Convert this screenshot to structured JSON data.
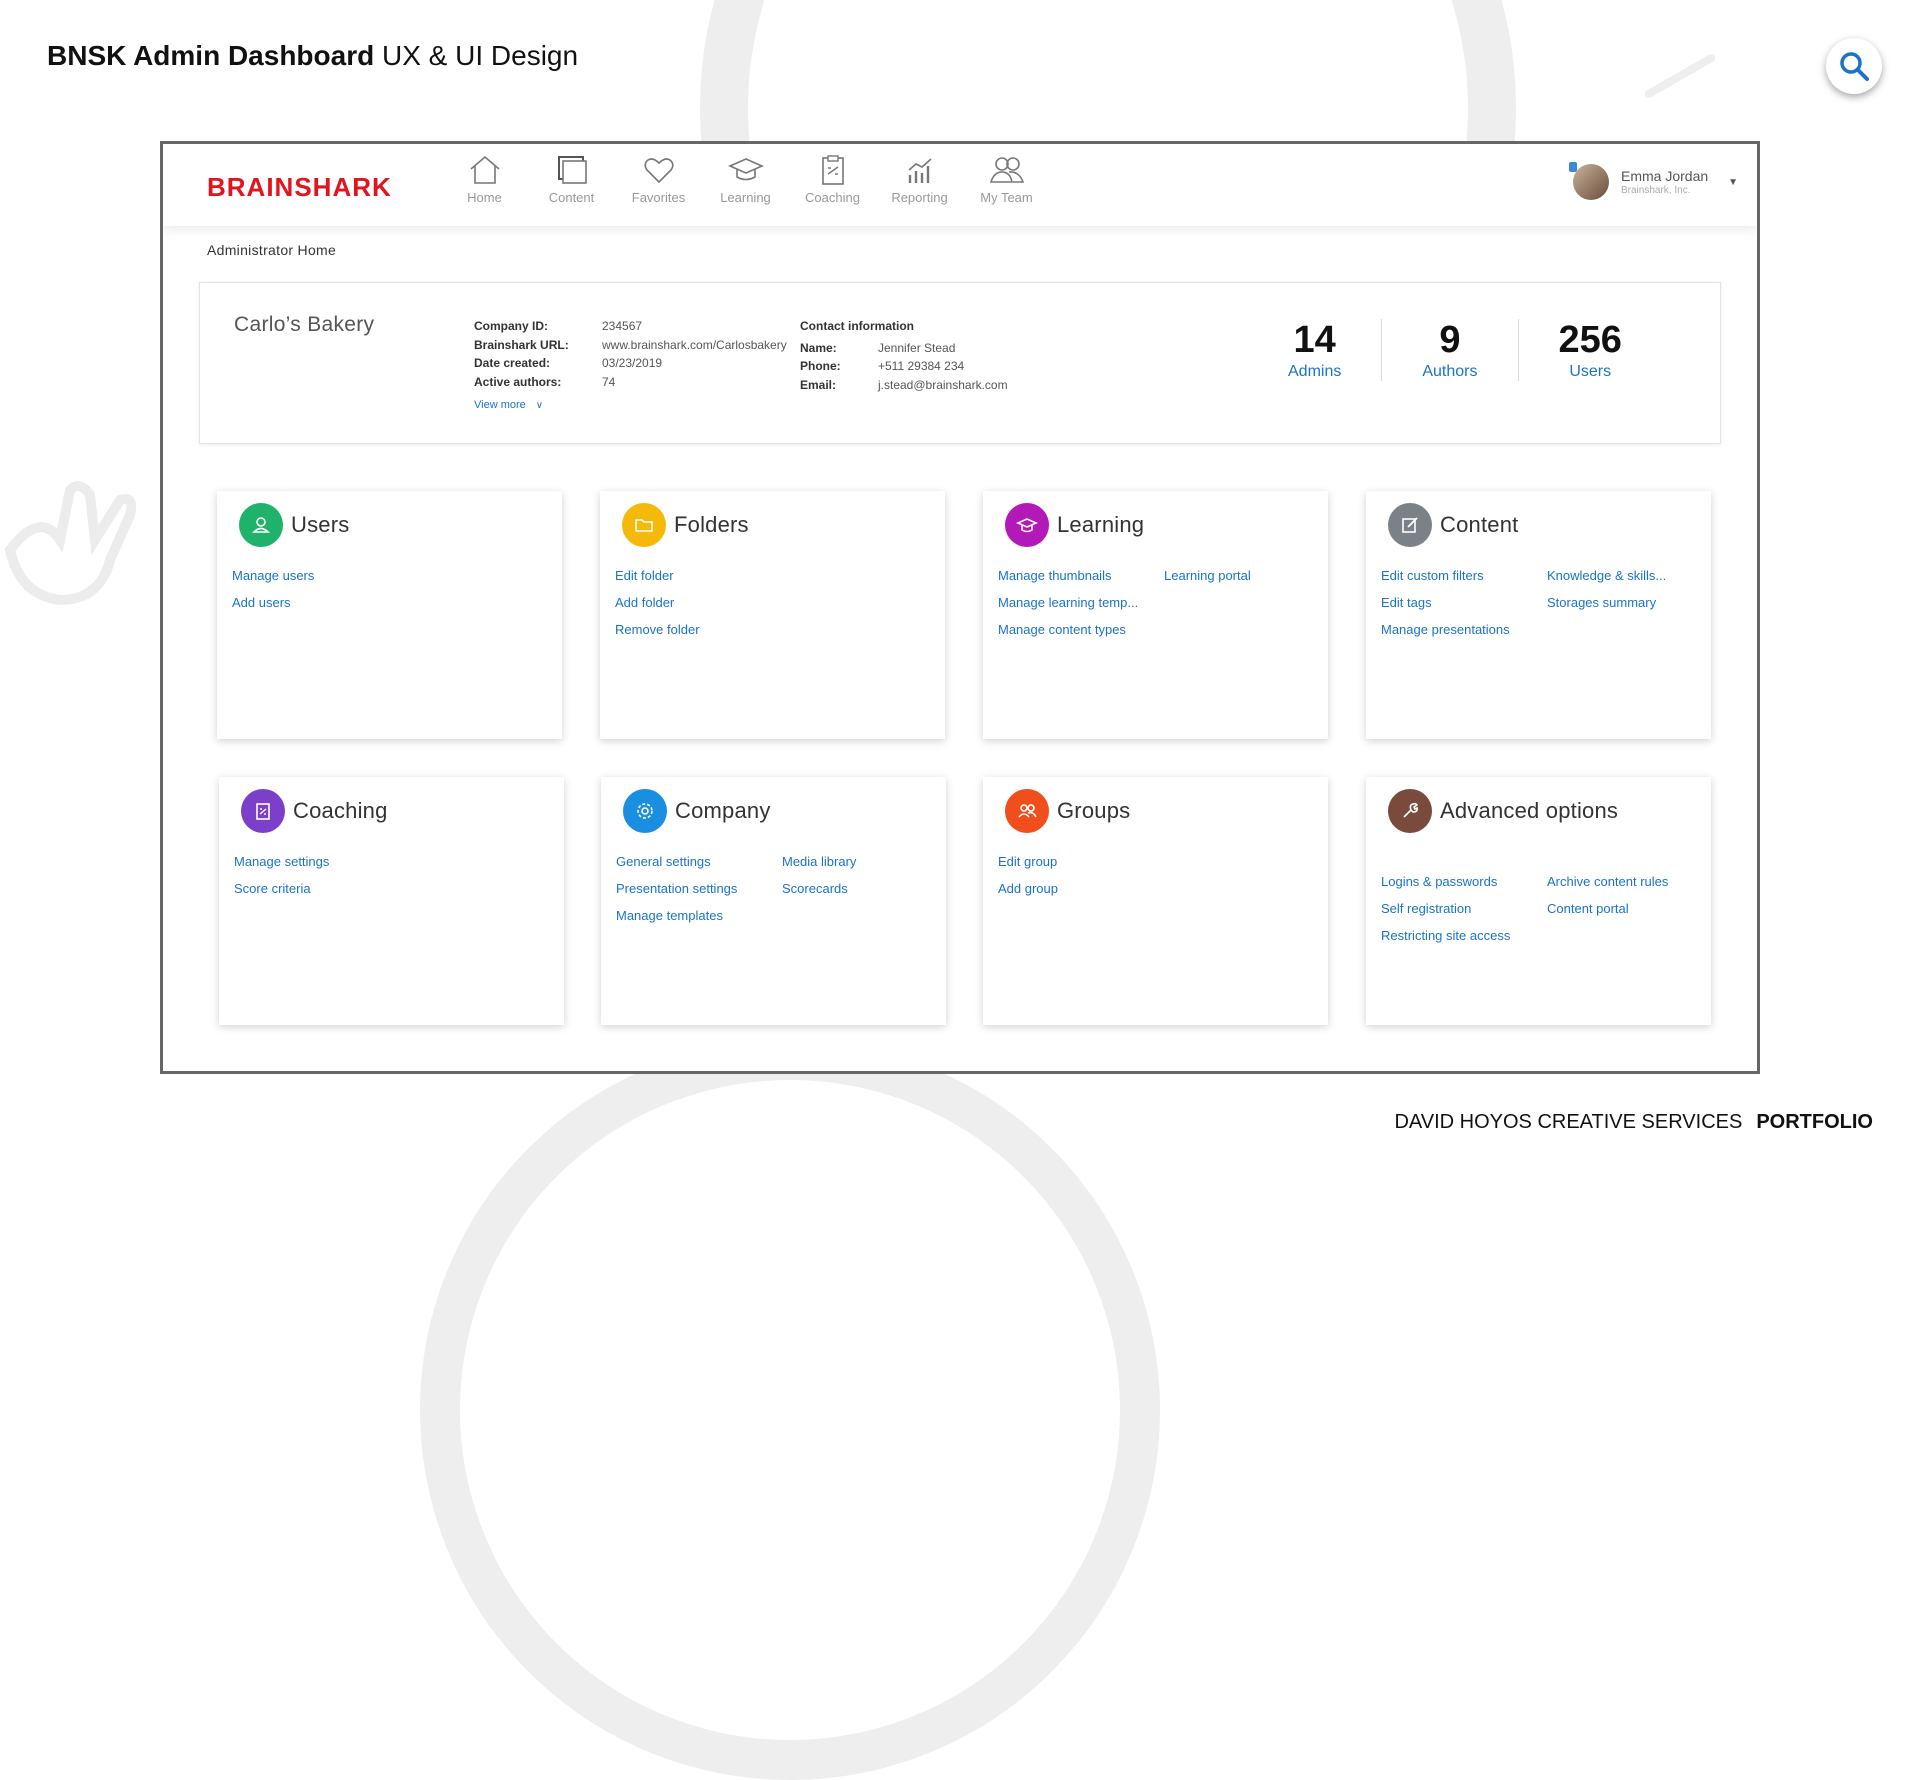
{
  "header": {
    "title_bold": "BNSK Admin Dashboard",
    "title_rest": "UX & UI Design"
  },
  "footer": {
    "studio": "DAVID HOYOS CREATIVE SERVICES",
    "portfolio": "PORTFOLIO"
  },
  "app": {
    "logo": "BRAINSHARK",
    "nav": [
      {
        "label": "Home",
        "icon": "home-icon"
      },
      {
        "label": "Content",
        "icon": "content-icon"
      },
      {
        "label": "Favorites",
        "icon": "heart-icon"
      },
      {
        "label": "Learning",
        "icon": "graduation-cap-icon"
      },
      {
        "label": "Coaching",
        "icon": "clipboard-icon"
      },
      {
        "label": "Reporting",
        "icon": "chart-icon"
      },
      {
        "label": "My Team",
        "icon": "team-icon"
      }
    ],
    "user": {
      "name": "Emma Jordan",
      "org": "Brainshark, Inc."
    },
    "breadcrumb": "Administrator Home"
  },
  "company": {
    "name": "Carlo’s Bakery",
    "details": [
      {
        "label": "Company ID:",
        "value": "234567"
      },
      {
        "label": "Brainshark URL:",
        "value": "www.brainshark.com/Carlosbakery"
      },
      {
        "label": "Date created:",
        "value": "03/23/2019"
      },
      {
        "label": "Active authors:",
        "value": "74"
      }
    ],
    "view_more": "View more",
    "contact": {
      "title": "Contact information",
      "rows": [
        {
          "label": "Name:",
          "value": "Jennifer Stead"
        },
        {
          "label": "Phone:",
          "value": "+511 29384 234"
        },
        {
          "label": "Email:",
          "value": "j.stead@brainshark.com"
        }
      ]
    },
    "stats": [
      {
        "value": "14",
        "label": "Admins"
      },
      {
        "value": "9",
        "label": "Authors"
      },
      {
        "value": "256",
        "label": "Users"
      }
    ]
  },
  "cards": [
    {
      "title": "Users",
      "color": "#1fb26b",
      "icon": "user-icon",
      "links": [
        "Manage users",
        "Add users"
      ]
    },
    {
      "title": "Folders",
      "color": "#f5b90a",
      "icon": "folder-icon",
      "links": [
        "Edit folder",
        "Add folder",
        "Remove folder"
      ]
    },
    {
      "title": "Learning",
      "color": "#b318b8",
      "icon": "graduation-cap-icon",
      "links": [
        "Manage thumbnails",
        "Learning portal",
        "Manage learning temp...",
        "",
        "Manage content types"
      ]
    },
    {
      "title": "Content",
      "color": "#7b8287",
      "icon": "edit-icon",
      "links": [
        "Edit custom filters",
        "Knowledge & skills...",
        "Edit tags",
        "Storages summary",
        "Manage presentations"
      ]
    },
    {
      "title": "Coaching",
      "color": "#7b3fc9",
      "icon": "clipboard-icon",
      "links": [
        "Manage settings",
        "Score criteria"
      ]
    },
    {
      "title": "Company",
      "color": "#1a8ee0",
      "icon": "gear-icon",
      "links": [
        "General settings",
        "Media library",
        "Presentation settings",
        "Scorecards",
        "Manage templates"
      ]
    },
    {
      "title": "Groups",
      "color": "#f04e1c",
      "icon": "group-icon",
      "links": [
        "Edit group",
        "Add group"
      ]
    },
    {
      "title": "Advanced options",
      "color": "#7a4a3c",
      "icon": "wrench-icon",
      "links": [
        "Logins & passwords",
        "Archive content rules",
        "Self registration",
        "Content portal",
        "Restricting site access"
      ]
    }
  ]
}
